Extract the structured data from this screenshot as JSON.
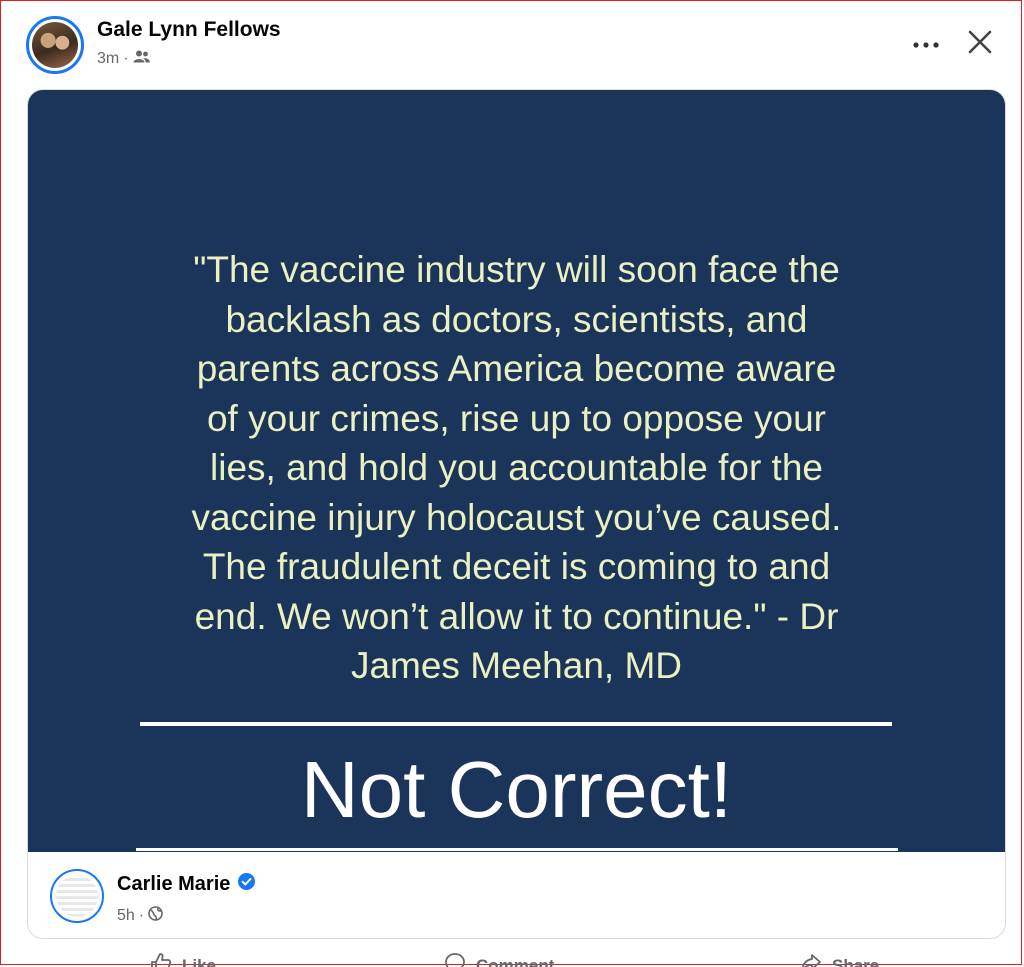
{
  "post": {
    "author": "Gale Lynn Fellows",
    "time": "3m",
    "separator": "·",
    "audience_icon": "friends-icon"
  },
  "shared_post": {
    "quote": "\"The vaccine industry will soon face the backlash as doctors, scientists, and parents across America become aware of your crimes, rise up to oppose your lies, and hold you accountable for the vaccine injury holocaust you’ve caused. The fraudulent deceit is coming to and end. We won’t allow it to continue.\" - Dr James Meehan, MD",
    "quote_lines": [
      "\"The vaccine industry will soon face the",
      "backlash as doctors, scientists, and",
      "parents across America become aware",
      "of your crimes, rise up to oppose your",
      "lies, and hold you accountable for the",
      "vaccine injury holocaust you’ve caused.",
      "The fraudulent deceit is coming to and",
      "end. We won’t allow it to continue.\" - Dr",
      "James Meehan, MD"
    ],
    "overlay_text": "Not Correct!",
    "author": "Carlie Marie",
    "verified": true,
    "time": "5h",
    "separator": "·",
    "audience_icon": "globe-icon"
  },
  "actions": {
    "like": "Like",
    "comment": "Comment",
    "share": "Share"
  },
  "colors": {
    "meme_background": "#1b3459",
    "quote_text": "#e9f0c2",
    "accent": "#1877f2",
    "meta_text": "#65676b"
  }
}
